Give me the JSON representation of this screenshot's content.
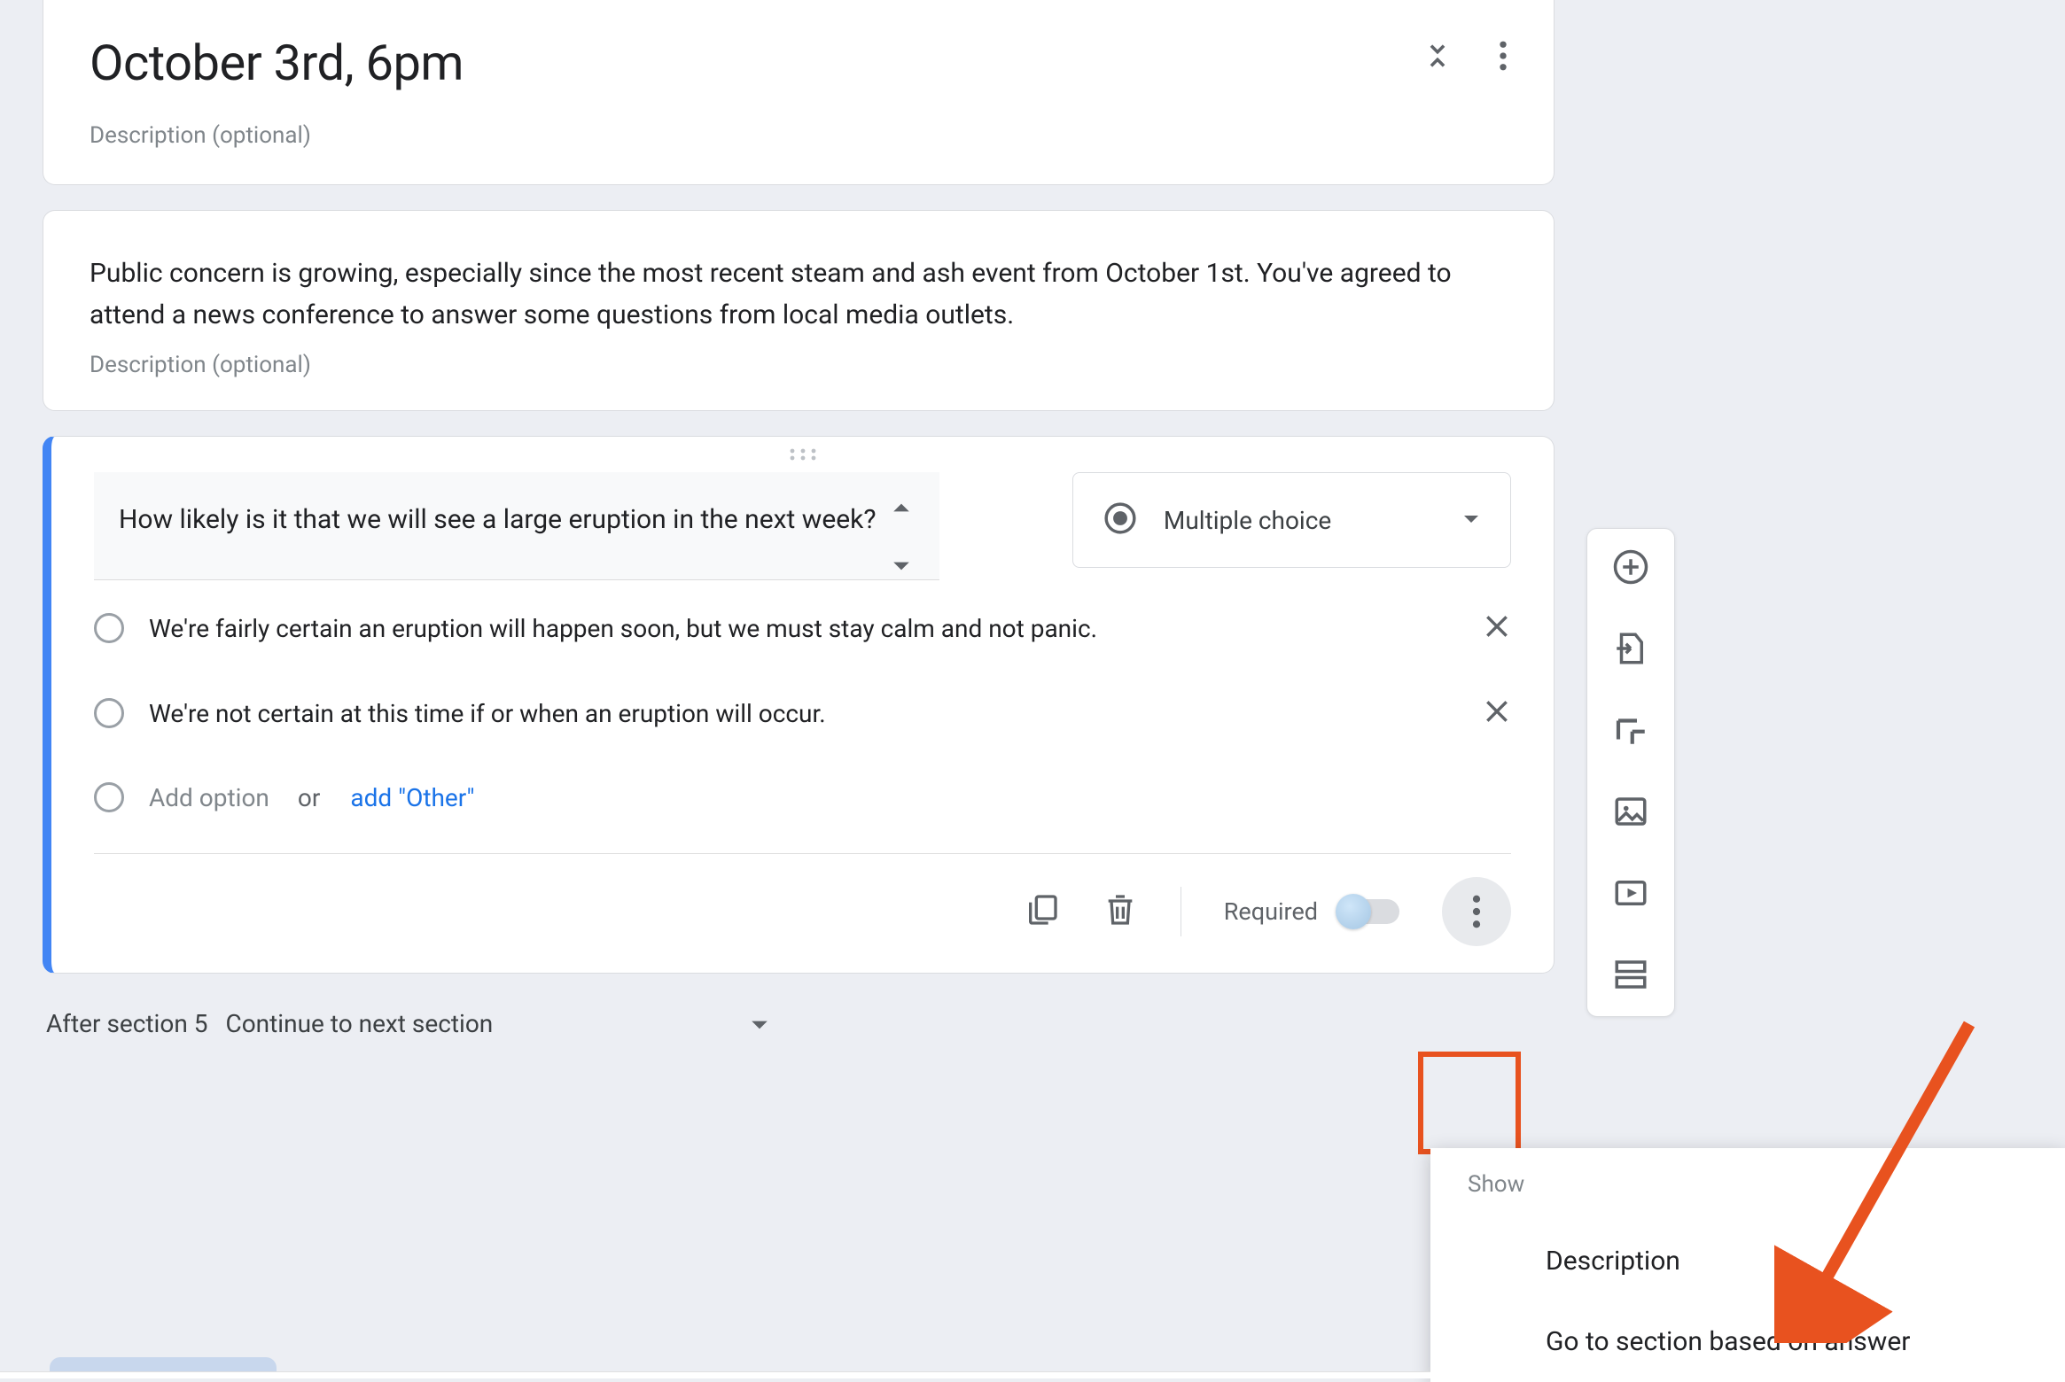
{
  "section": {
    "title": "October 3rd, 6pm",
    "description_placeholder": "Description (optional)"
  },
  "context": {
    "body": "Public concern is growing, especially since the most recent steam and ash event from October 1st. You've agreed to attend a news conference to answer some questions from local media outlets.",
    "description_placeholder": "Description (optional)"
  },
  "question": {
    "text": "How likely is it that we will see a large eruption in the next week?",
    "type_label": "Multiple choice",
    "options": [
      "We're fairly certain an eruption will happen soon, but we must stay calm and not panic.",
      "We're not certain at this time if or when an eruption will occur."
    ],
    "add_option": "Add option",
    "or": "or",
    "add_other": "add \"Other\""
  },
  "footer": {
    "required_label": "Required",
    "required_on": false
  },
  "after": {
    "prefix": "After section 5",
    "select": "Continue to next section"
  },
  "popup": {
    "head": "Show",
    "items": [
      "Description",
      "Go to section based on answer"
    ]
  },
  "colors": {
    "accent": "#4285f4",
    "annotation": "#e8521f"
  }
}
